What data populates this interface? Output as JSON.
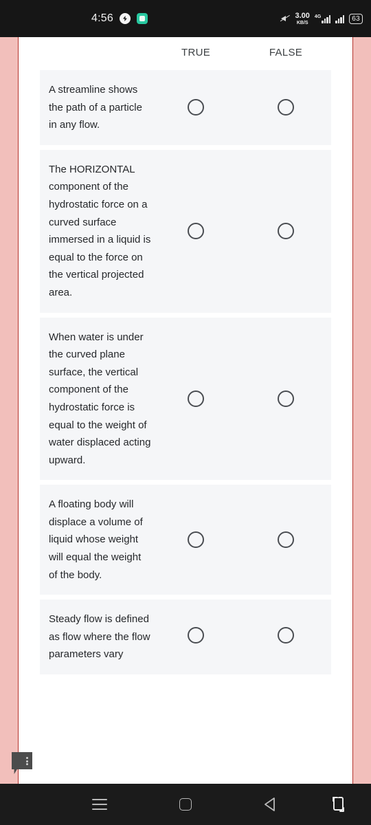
{
  "status_bar": {
    "time": "4:56",
    "messenger_icon": "messenger-icon",
    "app_icon": "app-icon",
    "mute_icon": "mute-icon",
    "net_speed_value": "3.00",
    "net_speed_unit": "KB/S",
    "network_type": "4G",
    "battery_level": "63"
  },
  "columns": {
    "true_label": "TRUE",
    "false_label": "FALSE"
  },
  "questions": [
    {
      "text": "A streamline shows the path of a particle in any flow.",
      "true_selected": false,
      "false_selected": false
    },
    {
      "text": "The HORIZONTAL component of the hydrostatic force on a curved surface immersed in a liquid is equal to the force on the vertical projected area.",
      "true_selected": false,
      "false_selected": false
    },
    {
      "text": "When water is under the curved plane surface, the vertical component of the hydrostatic force is equal to the weight of water displaced acting upward.",
      "true_selected": false,
      "false_selected": false
    },
    {
      "text": "A floating body will displace a volume of liquid whose weight will equal the weight of the body.",
      "true_selected": false,
      "false_selected": false
    },
    {
      "text": "Steady flow is defined as flow where the flow parameters vary",
      "true_selected": false,
      "false_selected": false
    }
  ],
  "feedback_flag": "feedback-flag-icon",
  "nav_bar": {
    "recents_label": "recents-icon",
    "home_label": "home-icon",
    "back_label": "back-icon",
    "rotate_label": "rotate-screen-icon"
  },
  "colors": {
    "rail": "#f2bfbb",
    "rail_border": "#b4342c",
    "card_bg": "#f5f6f8",
    "text": "#26282b",
    "radio_border": "#4a4d52",
    "status_bg": "#161616",
    "nav_bg": "#1b1b1b"
  }
}
